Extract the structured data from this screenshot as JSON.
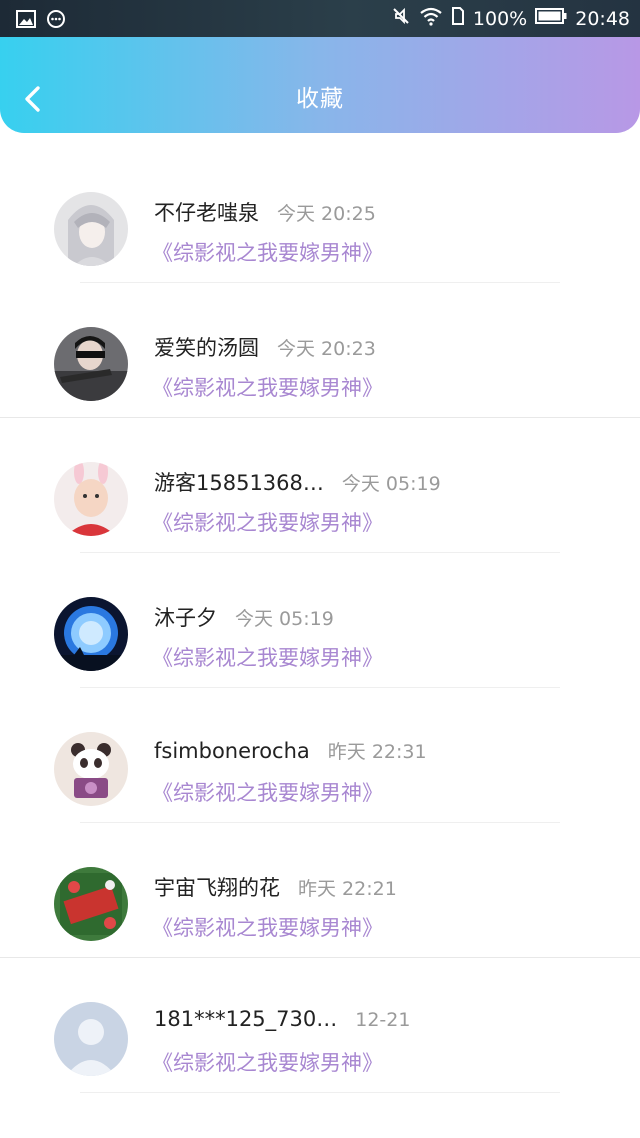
{
  "status_bar": {
    "battery": "100%",
    "time": "20:48"
  },
  "header": {
    "title": "收藏"
  },
  "items": [
    {
      "name": "不仔老嗤泉",
      "time": "今天 20:25",
      "book": "《综影视之我要嫁男神》"
    },
    {
      "name": "爱笑的汤圆",
      "time": "今天 20:23",
      "book": "《综影视之我要嫁男神》"
    },
    {
      "name": "游客15851368…",
      "time": "今天 05:19",
      "book": "《综影视之我要嫁男神》"
    },
    {
      "name": "沐子夕",
      "time": "今天 05:19",
      "book": "《综影视之我要嫁男神》"
    },
    {
      "name": "fsimbonerocha",
      "time": "昨天 22:31",
      "book": "《综影视之我要嫁男神》"
    },
    {
      "name": "宇宙飞翔的花",
      "time": "昨天 22:21",
      "book": "《综影视之我要嫁男神》"
    },
    {
      "name": "181***125_730…",
      "time": "12-21",
      "book": "《综影视之我要嫁男神》"
    }
  ]
}
